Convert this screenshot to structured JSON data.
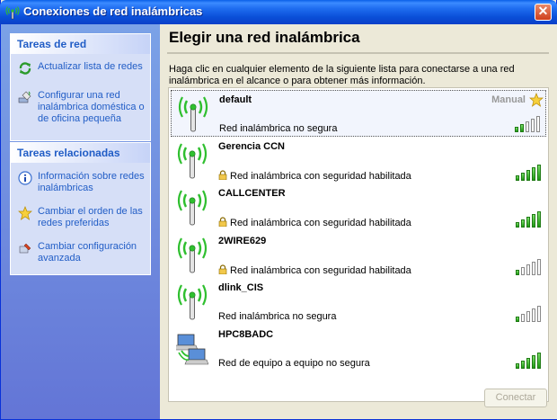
{
  "window": {
    "title": "Conexiones de red inalámbricas",
    "close_label": "✕"
  },
  "sidebar": {
    "network_tasks": {
      "title": "Tareas de red",
      "items": [
        {
          "label": "Actualizar lista de redes",
          "icon": "refresh-icon"
        },
        {
          "label": "Configurar una red inalámbrica doméstica o de oficina pequeña",
          "icon": "wireless-setup-icon"
        }
      ]
    },
    "related_tasks": {
      "title": "Tareas relacionadas",
      "items": [
        {
          "label": "Información sobre redes inalámbricas",
          "icon": "info-icon"
        },
        {
          "label": "Cambiar el orden de las redes preferidas",
          "icon": "star-icon"
        },
        {
          "label": "Cambiar configuración avanzada",
          "icon": "settings-icon"
        }
      ]
    }
  },
  "main": {
    "title": "Elegir una red inalámbrica",
    "instructions": "Haga clic en cualquier elemento de la siguiente lista para conectarse a una red inalámbrica en el alcance o para obtener más información.",
    "networks": [
      {
        "name": "default",
        "status": "Red inalámbrica no segura",
        "secured": false,
        "manual_label": "Manual",
        "preferred": true,
        "signal_level": 0.4,
        "type": "antenna-icon",
        "selected": true
      },
      {
        "name": "Gerencia CCN",
        "status": "Red inalámbrica con seguridad habilitada",
        "secured": true,
        "signal_level": 1.0,
        "type": "antenna-icon"
      },
      {
        "name": "CALLCENTER",
        "status": "Red inalámbrica con seguridad habilitada",
        "secured": true,
        "signal_level": 1.0,
        "type": "antenna-icon"
      },
      {
        "name": "2WIRE629",
        "status": "Red inalámbrica con seguridad habilitada",
        "secured": true,
        "signal_level": 0.2,
        "type": "antenna-icon"
      },
      {
        "name": "dlink_CIS",
        "status": "Red inalámbrica no segura",
        "secured": false,
        "signal_level": 0.2,
        "type": "antenna-icon"
      },
      {
        "name": "HPC8BADC",
        "status": "Red de equipo a equipo no segura",
        "secured": false,
        "signal_level": 1.0,
        "type": "computer-to-computer-icon"
      }
    ],
    "connect_label": "Conectar"
  },
  "colors": {
    "accent": "#215dc6",
    "signal_on": "#1f9a14",
    "titlebar": "#0a4fd8"
  }
}
